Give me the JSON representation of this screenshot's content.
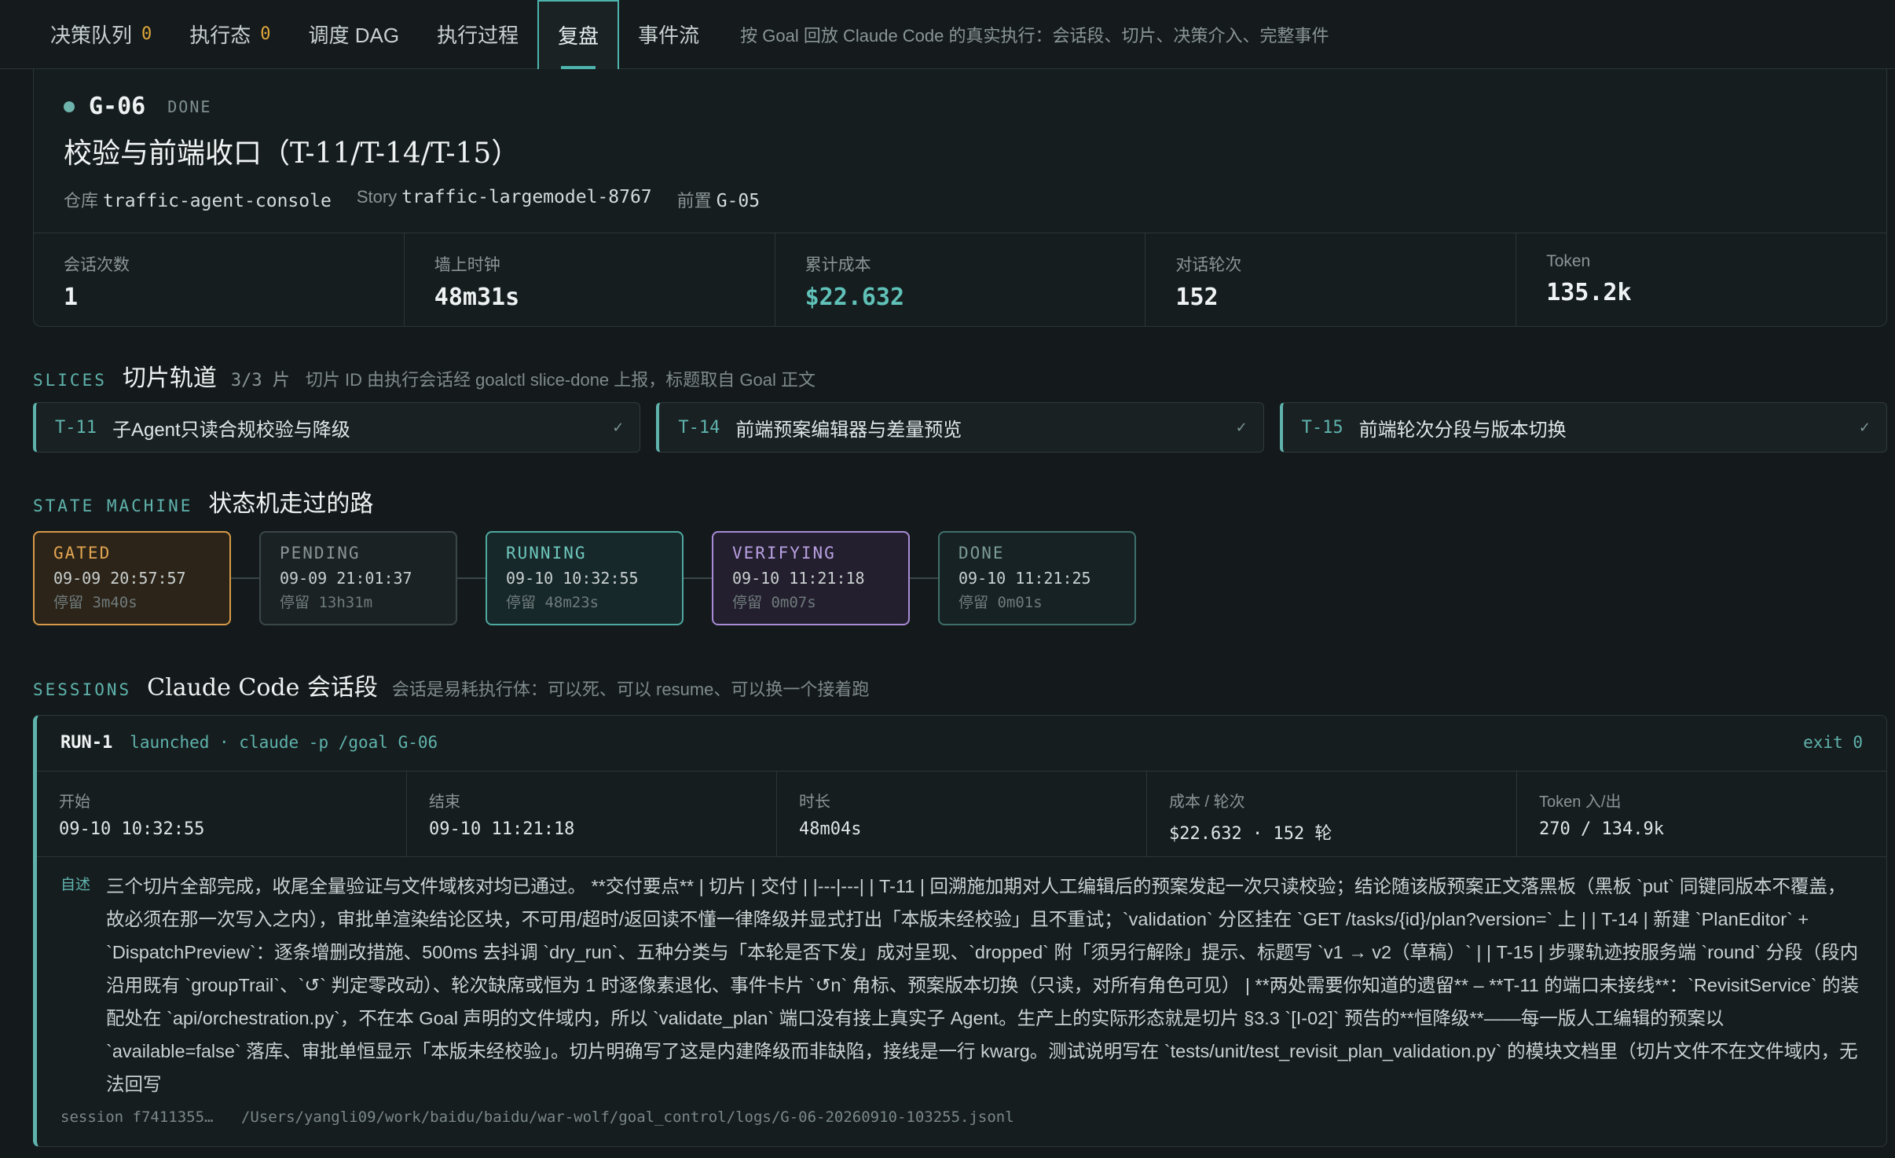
{
  "nav": {
    "tabs": [
      {
        "label": "决策队列",
        "count": "0"
      },
      {
        "label": "执行态",
        "count": "0"
      },
      {
        "label": "调度 DAG"
      },
      {
        "label": "执行过程"
      },
      {
        "label": "复盘"
      },
      {
        "label": "事件流"
      }
    ],
    "description": "按 Goal 回放 Claude Code 的真实执行：会话段、切片、决策介入、完整事件"
  },
  "goal": {
    "id": "G-06",
    "status": "DONE",
    "title": "校验与前端收口（T-11/T-14/T-15）",
    "repo_label": "仓库",
    "repo": "traffic-agent-console",
    "story_label": "Story",
    "story": "traffic-largemodel-8767",
    "prev_label": "前置",
    "prev": "G-05",
    "stats": [
      {
        "label": "会话次数",
        "value": "1"
      },
      {
        "label": "墙上时钟",
        "value": "48m31s"
      },
      {
        "label": "累计成本",
        "value": "$22.632"
      },
      {
        "label": "对话轮次",
        "value": "152"
      },
      {
        "label": "Token",
        "value": "135.2k"
      }
    ]
  },
  "slices": {
    "title_en": "SLICES",
    "title_zh": "切片轨道",
    "count": "3/3 片",
    "desc": "切片 ID 由执行会话经 goalctl slice-done 上报，标题取自 Goal 正文",
    "items": [
      {
        "id": "T-11",
        "title": "子Agent只读合规校验与降级",
        "check": "✓"
      },
      {
        "id": "T-14",
        "title": "前端预案编辑器与差量预览",
        "check": "✓"
      },
      {
        "id": "T-15",
        "title": "前端轮次分段与版本切换",
        "check": "✓"
      }
    ]
  },
  "state_machine": {
    "title_en": "STATE MACHINE",
    "title_zh": "状态机走过的路",
    "states": [
      {
        "name": "GATED",
        "time": "09-09 20:57:57",
        "dwell": "停留 3m40s"
      },
      {
        "name": "PENDING",
        "time": "09-09 21:01:37",
        "dwell": "停留 13h31m"
      },
      {
        "name": "RUNNING",
        "time": "09-10 10:32:55",
        "dwell": "停留 48m23s"
      },
      {
        "name": "VERIFYING",
        "time": "09-10 11:21:18",
        "dwell": "停留 0m07s"
      },
      {
        "name": "DONE",
        "time": "09-10 11:21:25",
        "dwell": "停留 0m01s"
      }
    ]
  },
  "sessions": {
    "title_en": "SESSIONS",
    "title_zh": "Claude Code 会话段",
    "desc": "会话是易耗执行体：可以死、可以 resume、可以换一个接着跑",
    "run": {
      "id": "RUN-1",
      "command": "launched · claude -p /goal G-06",
      "exit": "exit 0",
      "stats": [
        {
          "label": "开始",
          "value": "09-10 10:32:55"
        },
        {
          "label": "结束",
          "value": "09-10 11:21:18"
        },
        {
          "label": "时长",
          "value": "48m04s"
        },
        {
          "label": "成本 / 轮次",
          "value": "$22.632 · 152 轮"
        },
        {
          "label": "Token 入/出",
          "value": "270 / 134.9k"
        }
      ],
      "summary_tag": "自述",
      "summary": "三个切片全部完成，收尾全量验证与文件域核对均已通过。 **交付要点** | 切片 | 交付 | |---|---| | T-11 | 回溯施加期对人工编辑后的预案发起一次只读校验；结论随该版预案正文落黑板（黑板 `put` 同键同版本不覆盖，故必须在那一次写入之内），审批单渲染结论区块，不可用/超时/返回读不懂一律降级并显式打出「本版未经校验」且不重试；`validation` 分区挂在 `GET /tasks/{id}/plan?version=` 上 | | T-14 | 新建 `PlanEditor` + `DispatchPreview`：逐条增删改措施、500ms 去抖调 `dry_run`、五种分类与「本轮是否下发」成对呈现、`dropped` 附「须另行解除」提示、标题写 `v1 → v2（草稿）` | | T-15 | 步骤轨迹按服务端 `round` 分段（段内沿用既有 `groupTrail`、`↺` 判定零改动）、轮次缺席或恒为 1 时逐像素退化、事件卡片 `↺n` 角标、预案版本切换（只读，对所有角色可见） | **两处需要你知道的遗留** – **T-11 的端口未接线**：`RevisitService` 的装配处在 `api/orchestration.py`，不在本 Goal 声明的文件域内，所以 `validate_plan` 端口没有接上真实子 Agent。生产上的实际形态就是切片 §3.3 `[I-02]` 预告的**恒降级**——每一版人工编辑的预案以 `available=false` 落库、审批单恒显示「本版未经校验」。切片明确写了这是内建降级而非缺陷，接线是一行 kwarg。测试说明写在 `tests/unit/test_revisit_plan_validation.py` 的模块文档里（切片文件不在文件域内，无法回写",
      "session_id": "session f7411355…",
      "log_path": "/Users/yangli09/work/baidu/baidu/war-wolf/goal_control/logs/G-06-20260910-103255.jsonl"
    }
  }
}
